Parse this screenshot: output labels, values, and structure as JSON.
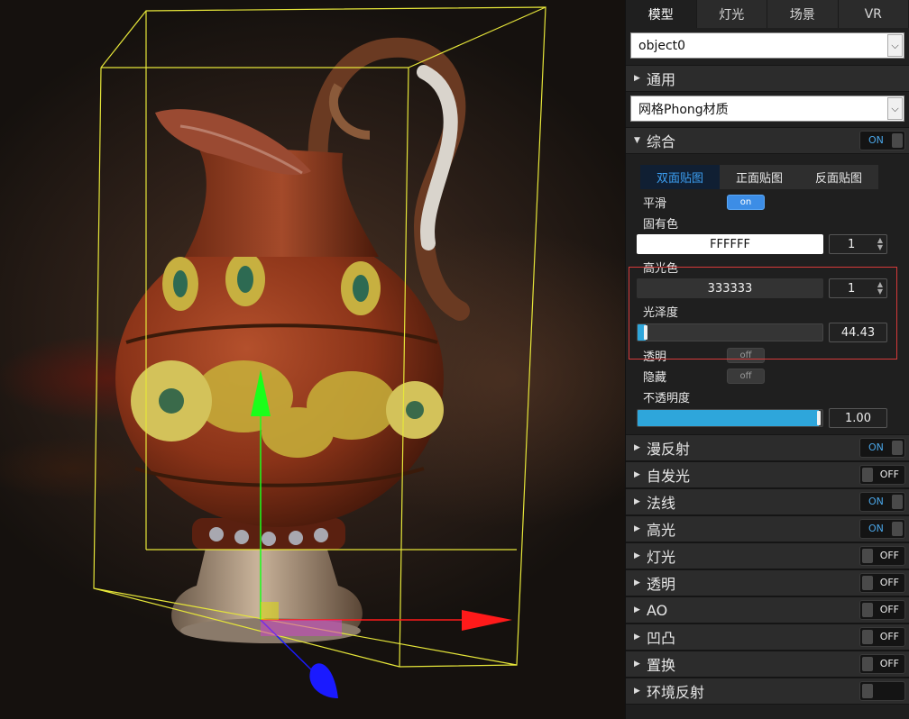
{
  "tabs": [
    "模型",
    "灯光",
    "场景",
    "VR"
  ],
  "active_tab": 0,
  "object_select": "object0",
  "general_label": "通用",
  "material_select": "网格Phong材质",
  "composite": {
    "label": "综合",
    "state": "ON",
    "subtabs": [
      "双面贴图",
      "正面贴图",
      "反面贴图"
    ],
    "active_subtab": 0,
    "smooth_label": "平滑",
    "smooth_state": "on",
    "base_color_label": "固有色",
    "base_color_value": "FFFFFF",
    "base_color_hex": "#FFFFFF",
    "base_color_factor": "1",
    "specular_color_label": "高光色",
    "specular_color_value": "333333",
    "specular_color_hex": "#333333",
    "specular_factor": "1",
    "gloss_label": "光泽度",
    "gloss_value": "44.43",
    "gloss_fraction": 0.045,
    "transparent_label": "透明",
    "transparent_state": "off",
    "hidden_label": "隐藏",
    "hidden_state": "off",
    "opacity_label": "不透明度",
    "opacity_value": "1.00",
    "opacity_fraction": 1.0
  },
  "sections": [
    {
      "label": "漫反射",
      "state": "ON"
    },
    {
      "label": "自发光",
      "state": "OFF"
    },
    {
      "label": "法线",
      "state": "ON"
    },
    {
      "label": "高光",
      "state": "ON"
    },
    {
      "label": "灯光",
      "state": "OFF"
    },
    {
      "label": "透明",
      "state": "OFF"
    },
    {
      "label": "AO",
      "state": "OFF"
    },
    {
      "label": "凹凸",
      "state": "OFF"
    },
    {
      "label": "置换",
      "state": "OFF"
    },
    {
      "label": "环境反射",
      "state": ""
    }
  ],
  "colors": {
    "accent": "#3c9ef0",
    "slider_fill": "#2ea6db",
    "highlight_frame": "#d63a3a",
    "bbox": "#e6e63a",
    "axis_x": "#ff1a1a",
    "axis_y": "#1aff1a",
    "axis_z": "#1a1aff"
  }
}
